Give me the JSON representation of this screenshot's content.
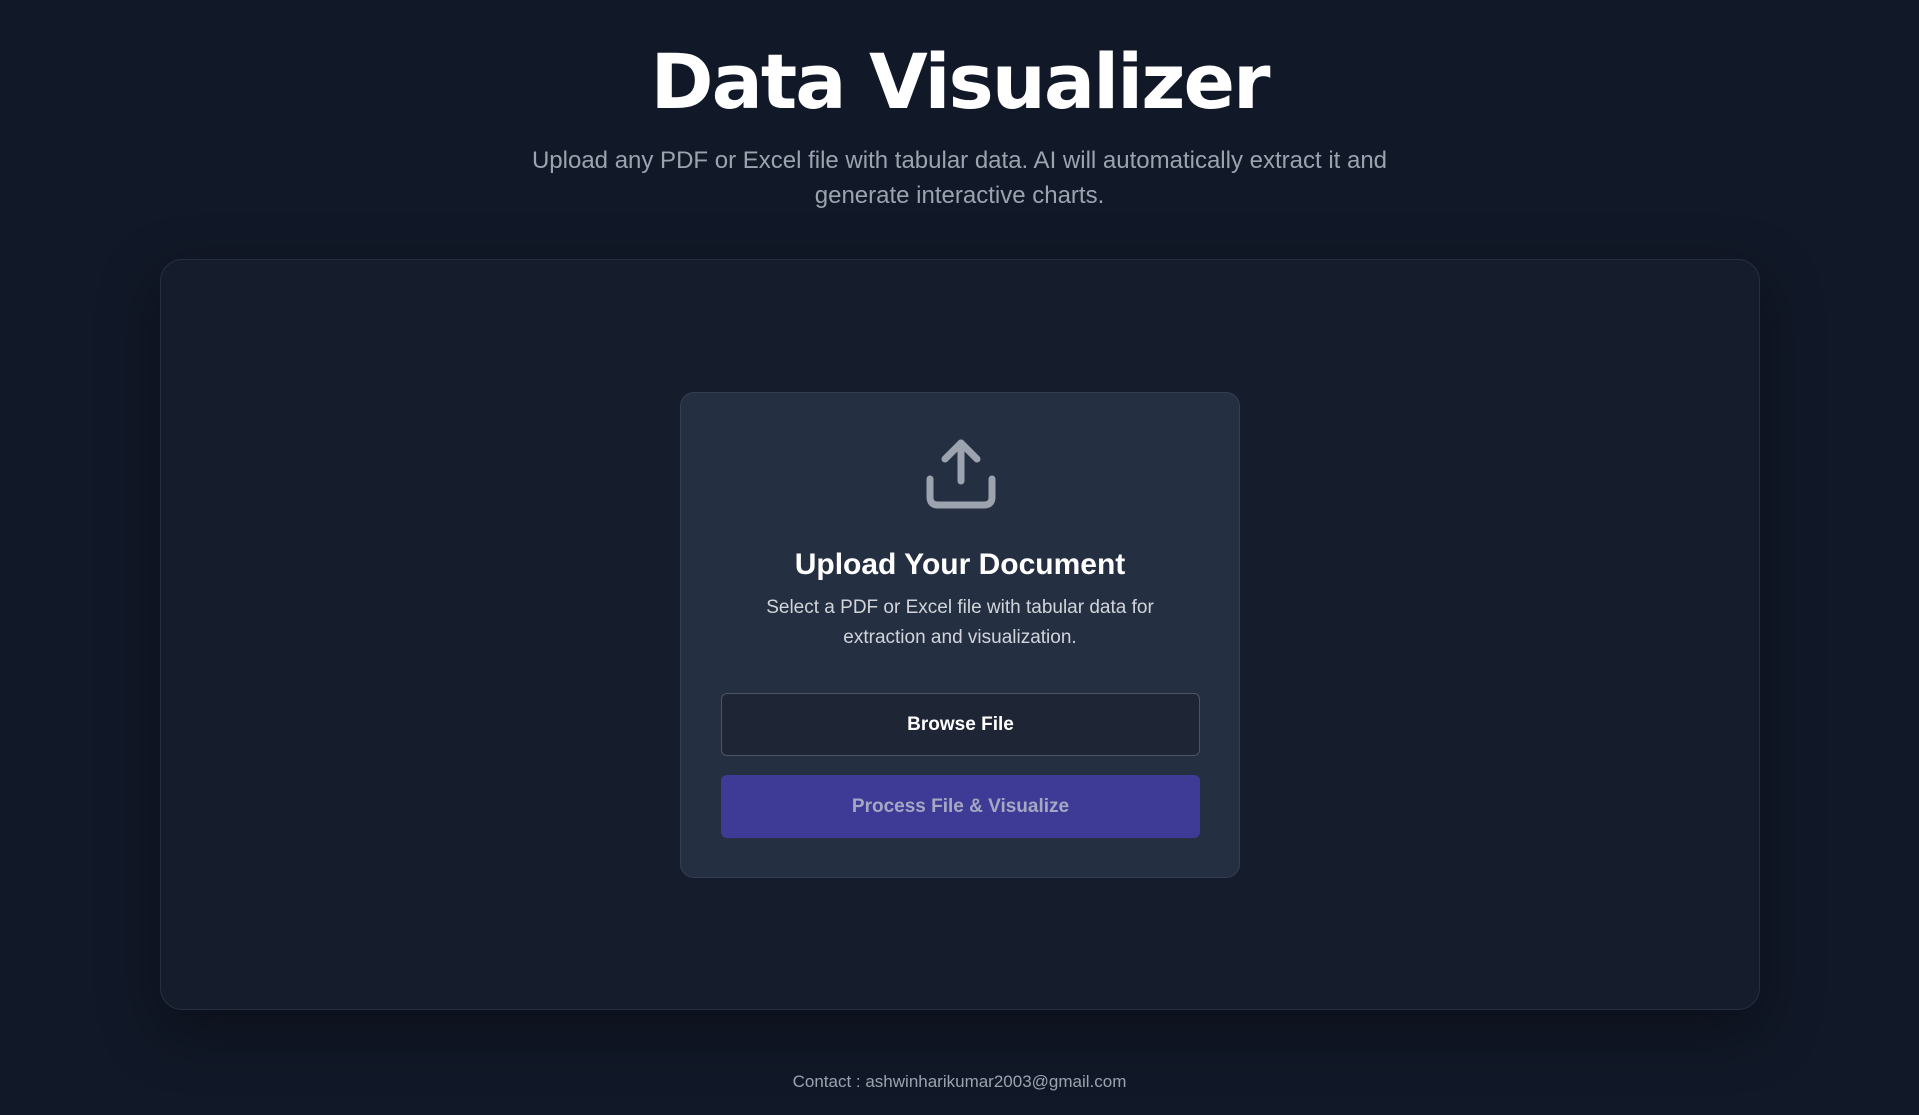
{
  "header": {
    "title": "Data Visualizer",
    "subtitle": "Upload any PDF or Excel file with tabular data. AI will automatically extract it and generate interactive charts."
  },
  "upload_card": {
    "icon": "upload-icon",
    "title": "Upload Your Document",
    "description": "Select a PDF or Excel file with tabular data for extraction and visualization.",
    "browse_label": "Browse File",
    "process_label": "Process File & Visualize",
    "process_disabled": true
  },
  "footer": {
    "contact": "Contact : ashwinharikumar2003@gmail.com"
  },
  "colors": {
    "background": "#111827",
    "panel": "#151c2c",
    "card": "#252f42",
    "accent": "#3d3b95",
    "muted_text": "#9ca3af"
  }
}
